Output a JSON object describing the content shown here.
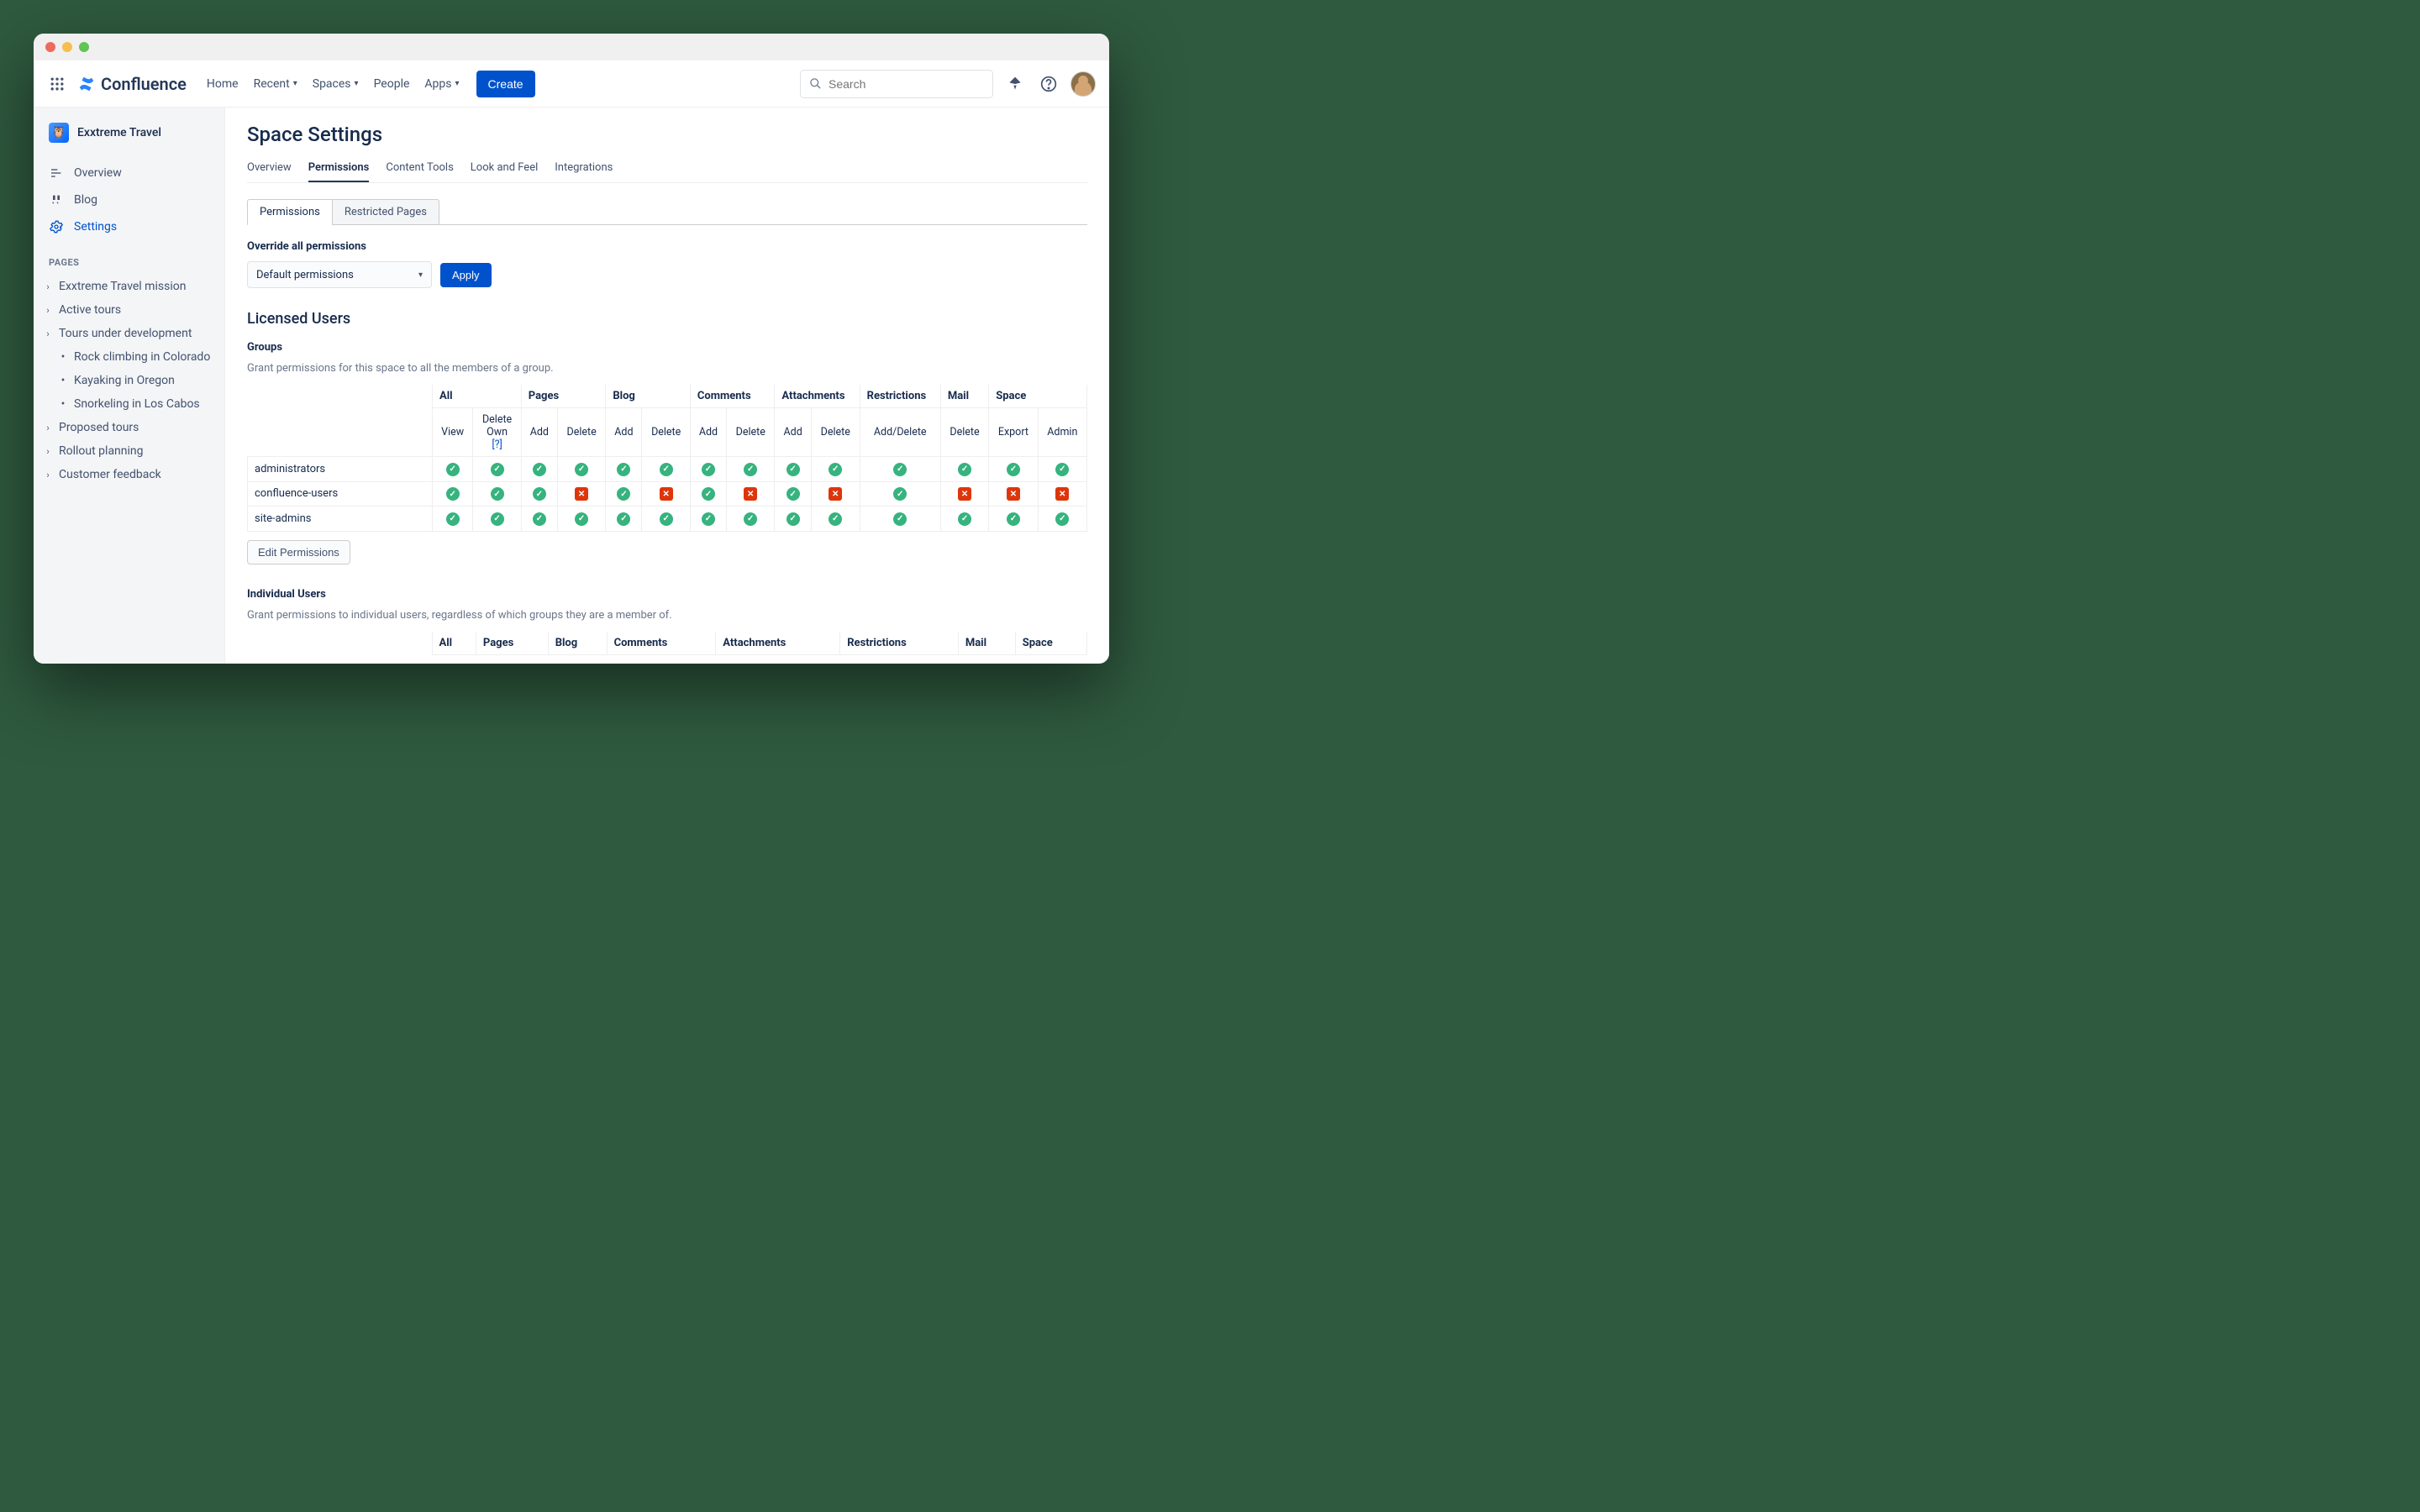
{
  "topbar": {
    "product": "Confluence",
    "nav": [
      "Home",
      "Recent",
      "Spaces",
      "People",
      "Apps"
    ],
    "nav_has_chevron": [
      false,
      true,
      true,
      false,
      true
    ],
    "create": "Create",
    "search_placeholder": "Search"
  },
  "sidebar": {
    "space_name": "Exxtreme Travel",
    "items": [
      {
        "icon": "overview",
        "label": "Overview"
      },
      {
        "icon": "blog",
        "label": "Blog"
      },
      {
        "icon": "settings",
        "label": "Settings",
        "active": true
      }
    ],
    "pages_label": "PAGES",
    "tree": [
      {
        "label": "Exxtreme Travel mission",
        "expandable": true
      },
      {
        "label": "Active tours",
        "expandable": true
      },
      {
        "label": "Tours under development",
        "expandable": true,
        "children": [
          {
            "label": "Rock climbing in Colorado"
          },
          {
            "label": "Kayaking in Oregon"
          },
          {
            "label": "Snorkeling in Los Cabos"
          }
        ]
      },
      {
        "label": "Proposed tours",
        "expandable": true
      },
      {
        "label": "Rollout planning",
        "expandable": true
      },
      {
        "label": "Customer feedback",
        "expandable": true
      }
    ]
  },
  "main": {
    "title": "Space Settings",
    "tabs_primary": [
      "Overview",
      "Permissions",
      "Content Tools",
      "Look and Feel",
      "Integrations"
    ],
    "tab_primary_active": 1,
    "tabs_secondary": [
      "Permissions",
      "Restricted Pages"
    ],
    "tab_secondary_active": 0,
    "override": {
      "heading": "Override all permissions",
      "select_value": "Default permissions",
      "apply": "Apply"
    },
    "licensed_heading": "Licensed Users",
    "groups": {
      "heading": "Groups",
      "desc": "Grant permissions for this space to all the members of a group.",
      "col_groups": [
        "All",
        "Pages",
        "Blog",
        "Comments",
        "Attachments",
        "Restrictions",
        "Mail",
        "Space"
      ],
      "col_spans": [
        2,
        2,
        2,
        2,
        2,
        1,
        1,
        2
      ],
      "sub_cols": [
        "View",
        "Delete Own",
        "Add",
        "Delete",
        "Add",
        "Delete",
        "Add",
        "Delete",
        "Add",
        "Delete",
        "Add/Delete",
        "Delete",
        "Export",
        "Admin"
      ],
      "delete_own_help": "[?]",
      "rows": [
        {
          "name": "administrators",
          "cells": [
            1,
            1,
            1,
            1,
            1,
            1,
            1,
            1,
            1,
            1,
            1,
            1,
            1,
            1
          ]
        },
        {
          "name": "confluence-users",
          "cells": [
            1,
            1,
            1,
            0,
            1,
            0,
            1,
            0,
            1,
            0,
            1,
            0,
            0,
            0
          ]
        },
        {
          "name": "site-admins",
          "cells": [
            1,
            1,
            1,
            1,
            1,
            1,
            1,
            1,
            1,
            1,
            1,
            1,
            1,
            1
          ]
        }
      ],
      "edit_button": "Edit Permissions"
    },
    "individual": {
      "heading": "Individual Users",
      "desc": "Grant permissions to individual users, regardless of which groups they are a member of.",
      "col_groups": [
        "All",
        "Pages",
        "Blog",
        "Comments",
        "Attachments",
        "Restrictions",
        "Mail",
        "Space"
      ]
    }
  }
}
